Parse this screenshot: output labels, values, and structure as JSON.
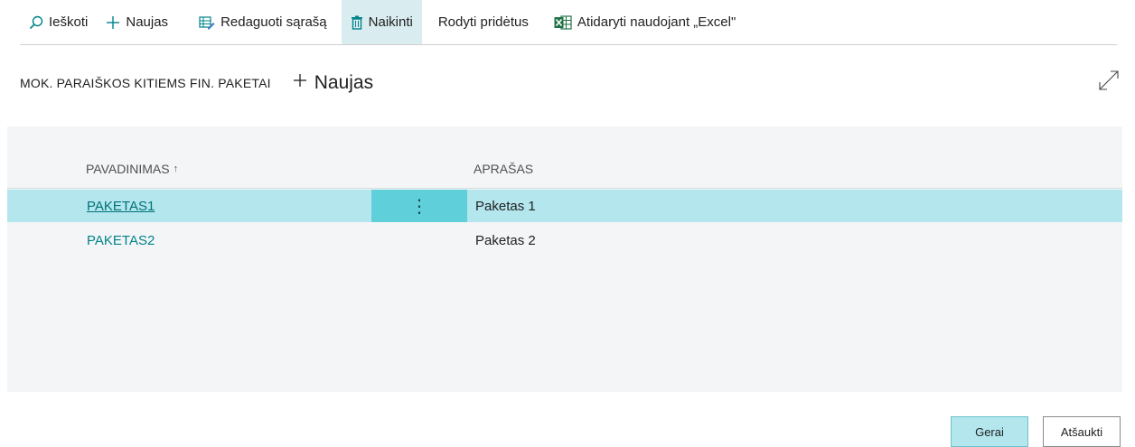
{
  "toolbar": {
    "search": "Ieškoti",
    "new": "Naujas",
    "edit_list": "Redaguoti sąrašą",
    "delete": "Naikinti",
    "show_attached": "Rodyti pridėtus",
    "open_excel": "Atidaryti naudojant „Excel\""
  },
  "page": {
    "title": "MOK. PARAIŠKOS KITIEMS FIN. PAKETAI",
    "new_label": "Naujas"
  },
  "table": {
    "columns": [
      "PAVADINIMAS",
      "APRAŠAS"
    ],
    "sort_indicator": "↑",
    "rows": [
      {
        "name": "PAKETAS1",
        "description": "Paketas 1",
        "selected": true
      },
      {
        "name": "PAKETAS2",
        "description": "Paketas 2",
        "selected": false
      }
    ],
    "row_menu_glyph": "⋮"
  },
  "footer": {
    "ok": "Gerai",
    "cancel": "Atšaukti"
  },
  "colors": {
    "accent": "#00838a",
    "selected_row": "#b3e6ed",
    "menu_cell": "#5fcfd9",
    "excel_green": "#217346"
  },
  "icons": {
    "search": "search-icon",
    "new": "plus-icon",
    "edit_list": "edit-list-icon",
    "delete": "trash-icon",
    "excel": "excel-icon",
    "expand": "expand-icon"
  }
}
